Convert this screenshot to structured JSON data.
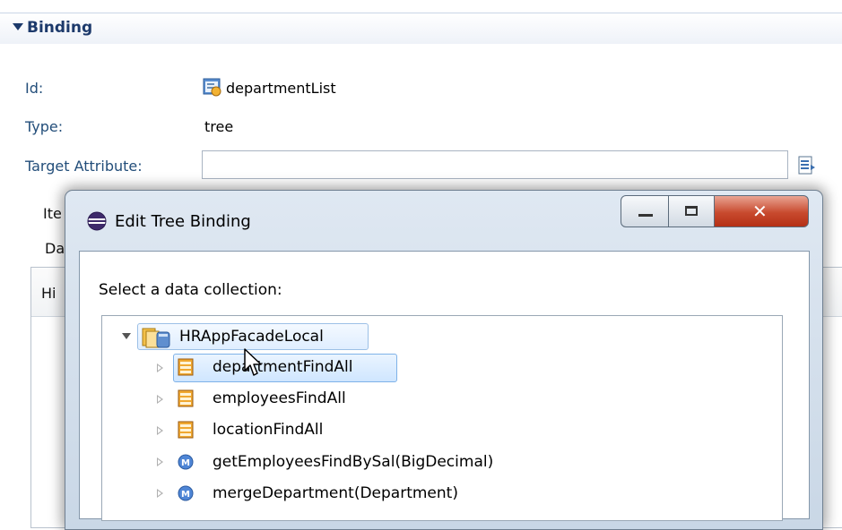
{
  "section": {
    "title": "Binding"
  },
  "fields": {
    "id_label": "Id:",
    "id_value": "departmentList",
    "type_label": "Type:",
    "type_value": "tree",
    "target_label": "Target Attribute:",
    "target_value": ""
  },
  "background_fragments": {
    "item": "Ite",
    "da": "Da",
    "hi": "Hi"
  },
  "dialog": {
    "title": "Edit Tree Binding",
    "prompt": "Select a data collection:",
    "tree": {
      "root": "HRAppFacadeLocal",
      "children": [
        {
          "label": "departmentFindAll",
          "icon": "collection-icon"
        },
        {
          "label": "employeesFindAll",
          "icon": "collection-icon"
        },
        {
          "label": "locationFindAll",
          "icon": "collection-icon"
        },
        {
          "label": "getEmployeesFindBySal(BigDecimal)",
          "icon": "method-icon"
        },
        {
          "label": "mergeDepartment(Department)",
          "icon": "method-icon"
        }
      ]
    }
  },
  "colors": {
    "accent": "#1d3a6b",
    "label": "#234e7a",
    "selection": "#cfe6ff",
    "close": "#c84a2e"
  }
}
